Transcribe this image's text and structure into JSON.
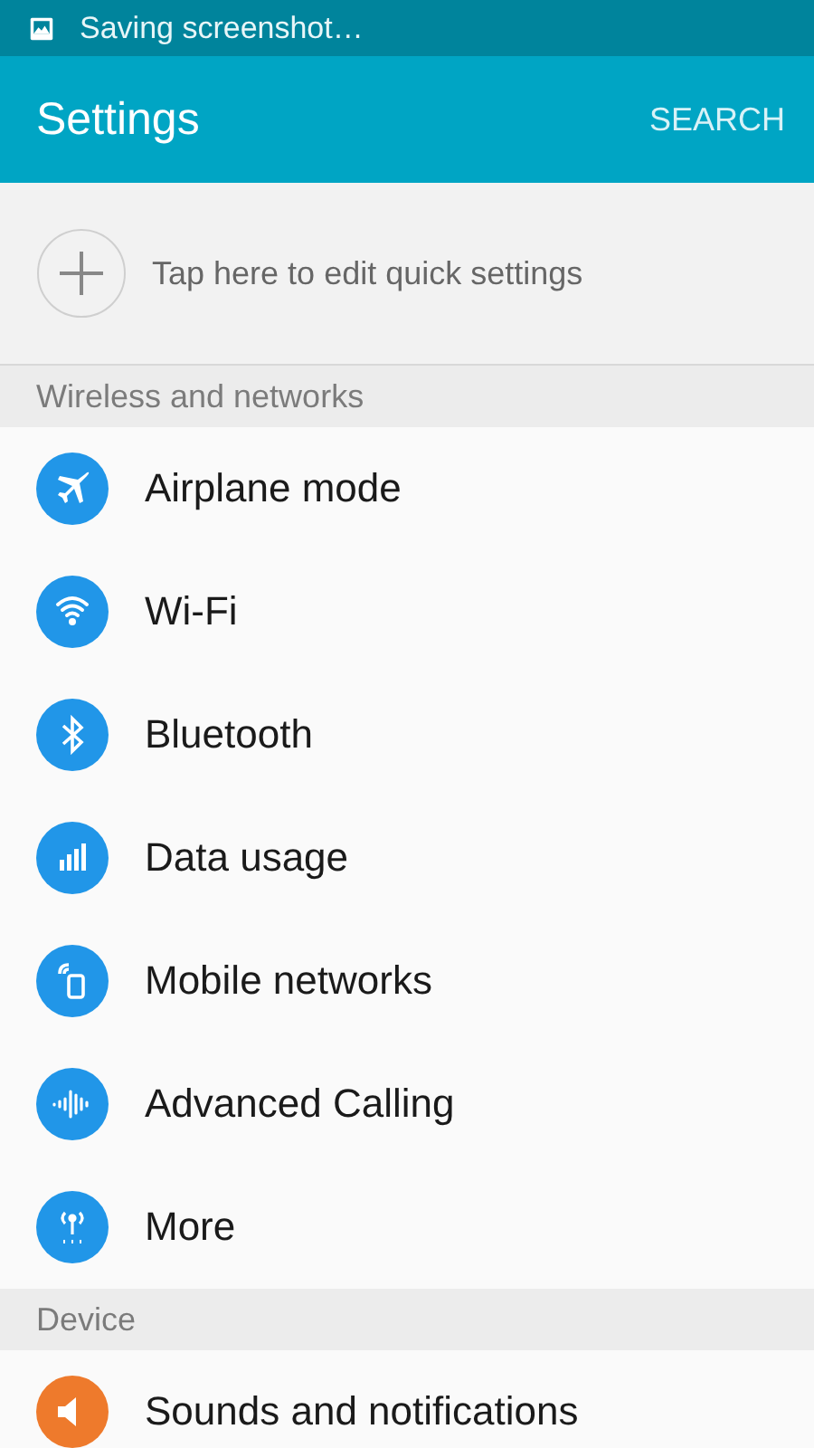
{
  "status_bar": {
    "notification": "Saving screenshot…"
  },
  "app_bar": {
    "title": "Settings",
    "action": "SEARCH"
  },
  "quick_settings": {
    "label": "Tap here to edit quick settings"
  },
  "sections": [
    {
      "title": "Wireless and networks",
      "items": [
        {
          "label": "Airplane mode",
          "kind": "airplane",
          "color": "#2196e8"
        },
        {
          "label": "Wi-Fi",
          "kind": "wifi",
          "color": "#2196e8"
        },
        {
          "label": "Bluetooth",
          "kind": "bluetooth",
          "color": "#2196e8"
        },
        {
          "label": "Data usage",
          "kind": "data",
          "color": "#2196e8"
        },
        {
          "label": "Mobile networks",
          "kind": "mobile",
          "color": "#2196e8"
        },
        {
          "label": "Advanced Calling",
          "kind": "calling",
          "color": "#2196e8"
        },
        {
          "label": "More",
          "kind": "more",
          "color": "#2196e8"
        }
      ]
    },
    {
      "title": "Device",
      "items": [
        {
          "label": "Sounds and notifications",
          "kind": "sound",
          "color": "#ee7a2c"
        }
      ]
    }
  ]
}
